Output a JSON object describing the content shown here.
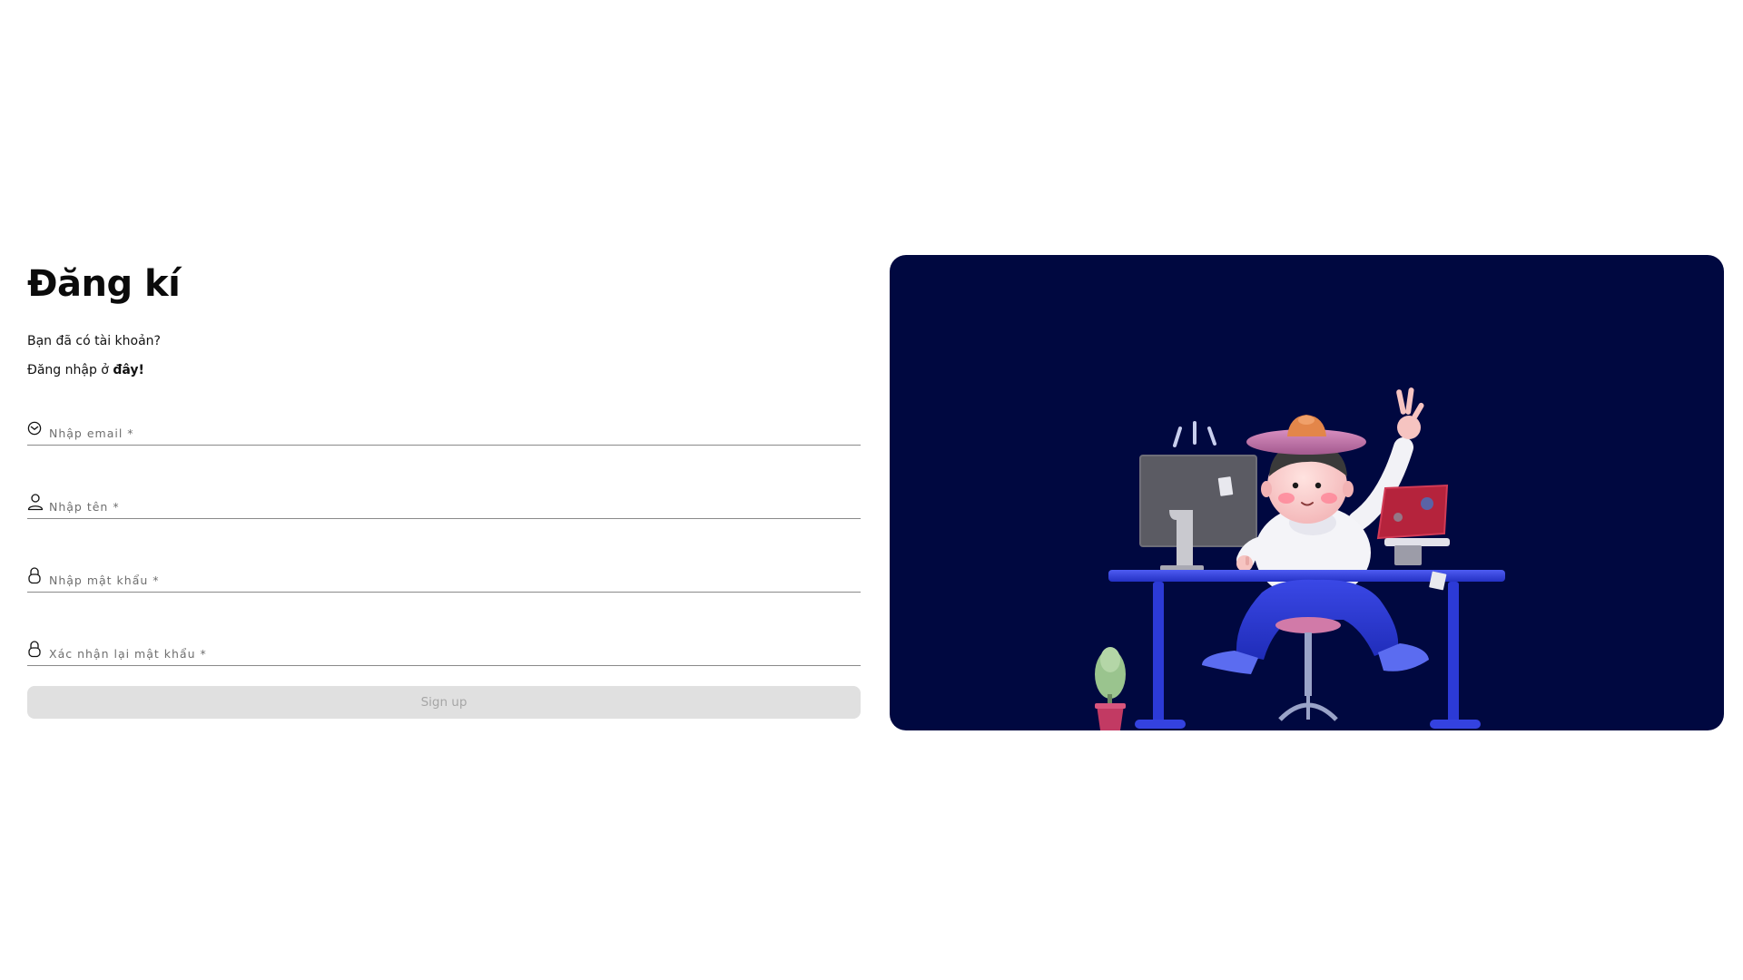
{
  "signup": {
    "title": "Đăng kí",
    "have_account": "Bạn đã có tài khoản?",
    "login_prefix": "Đăng nhập ở ",
    "login_link": "đây!",
    "fields": [
      {
        "icon": "mail-icon",
        "placeholder": "Nhập email *",
        "value": ""
      },
      {
        "icon": "user-icon",
        "placeholder": "Nhập tên *",
        "value": ""
      },
      {
        "icon": "lock-icon",
        "placeholder": "Nhập mật khẩu *",
        "value": ""
      },
      {
        "icon": "lock-icon",
        "placeholder": "Xác nhận lại mật khẩu *",
        "value": ""
      }
    ],
    "submit_label": "Sign up",
    "submit_enabled": false
  },
  "illustration": {
    "background_color": "#000840",
    "accent_color": "#2f3fd8"
  }
}
